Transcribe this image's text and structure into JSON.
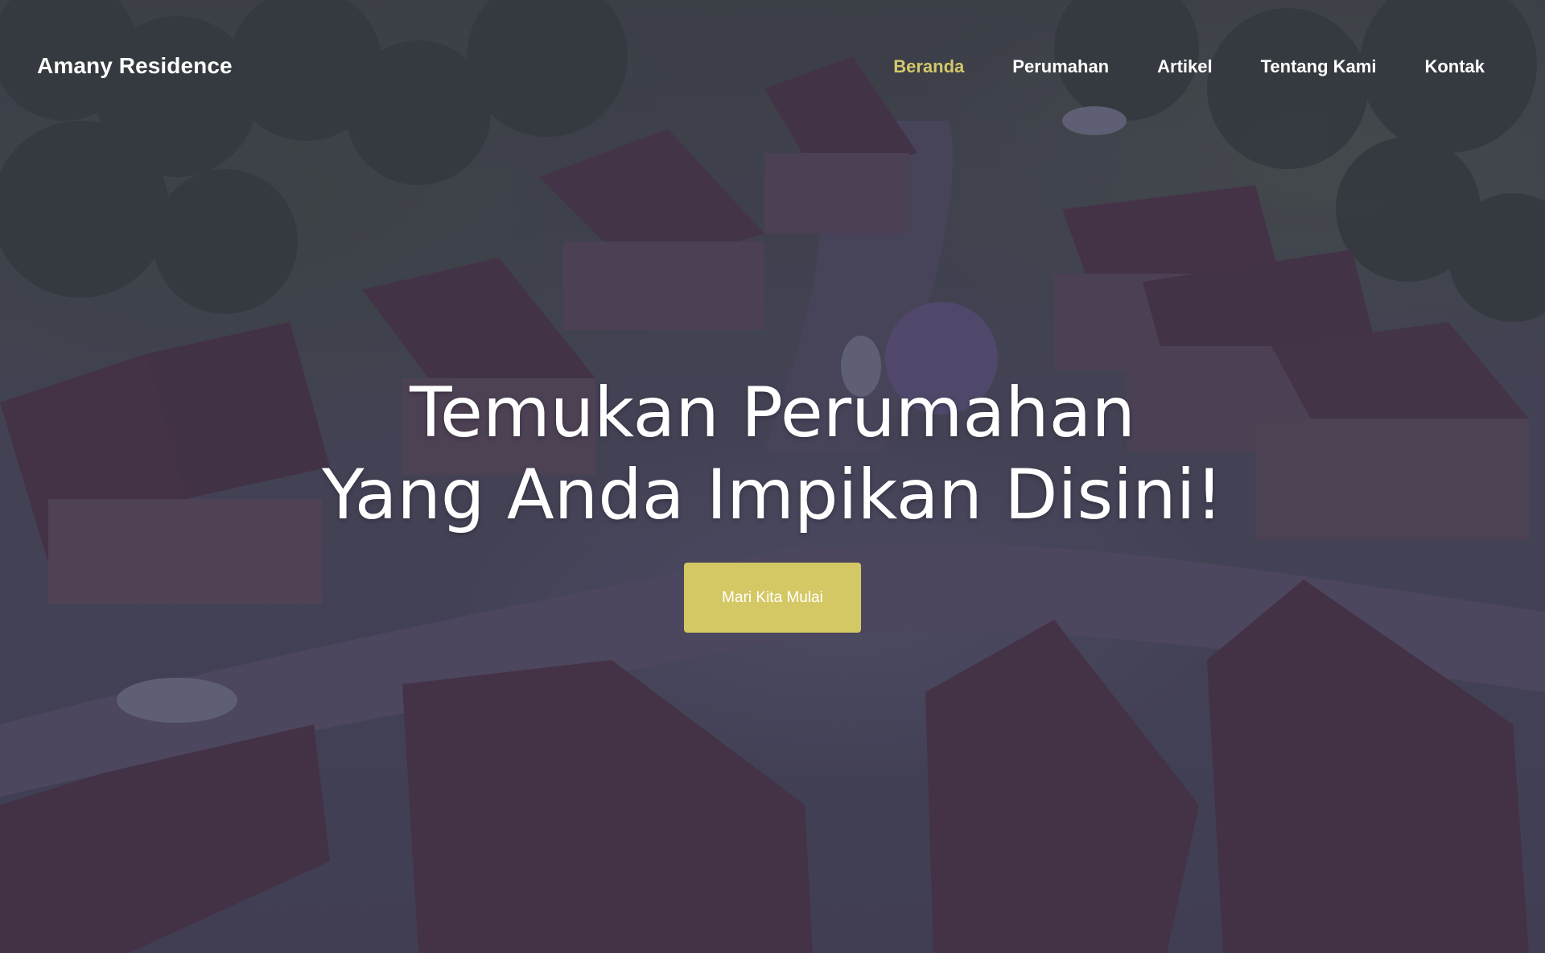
{
  "brand": "Amany Residence",
  "nav": {
    "items": [
      {
        "label": "Beranda",
        "active": true
      },
      {
        "label": "Perumahan",
        "active": false
      },
      {
        "label": "Artikel",
        "active": false
      },
      {
        "label": "Tentang Kami",
        "active": false
      },
      {
        "label": "Kontak",
        "active": false
      }
    ]
  },
  "hero": {
    "title_line1": "Temukan Perumahan",
    "title_line2": "Yang Anda Impikan Disini!",
    "cta_label": "Mari Kita Mulai",
    "background": "aerial-housing-illustration"
  },
  "colors": {
    "accent": "#d4c865",
    "nav_active": "#d4c86a",
    "overlay": "#28264680"
  }
}
